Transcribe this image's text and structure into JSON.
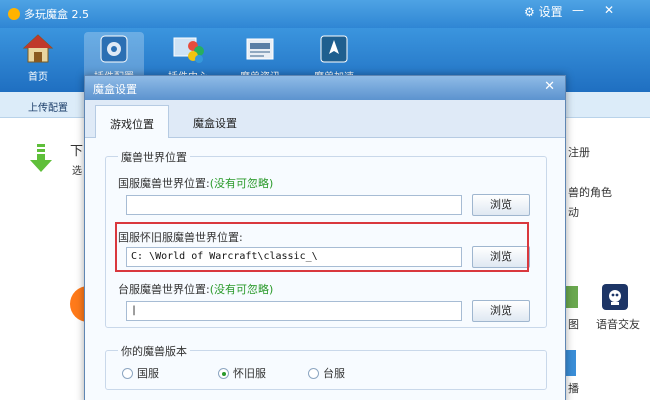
{
  "app": {
    "title": "多玩魔盒 2.5",
    "settings_label": "设置",
    "minimize": "—",
    "close": "✕"
  },
  "toolbar": {
    "items": [
      {
        "label": "首页",
        "icon": "home-icon"
      },
      {
        "label": "插件配置",
        "icon": "plugin-config-icon"
      },
      {
        "label": "插件中心",
        "icon": "plugin-center-icon"
      },
      {
        "label": "魔兽资讯",
        "icon": "news-icon"
      },
      {
        "label": "魔兽加速",
        "icon": "accelerate-icon"
      }
    ]
  },
  "subbar": {
    "upload_label": "上传配置"
  },
  "background": {
    "down_text": "下",
    "select_text": "选",
    "register_text": "注册",
    "role_text": "兽的角色",
    "move_text": "动",
    "map_text": "图",
    "voice_text": "语音交友",
    "broadcast_text": "播"
  },
  "dialog": {
    "title": "魔盒设置",
    "close": "✕",
    "tabs": [
      {
        "label": "游戏位置",
        "active": true
      },
      {
        "label": "魔盒设置",
        "active": false
      }
    ],
    "location_group": {
      "title": "魔兽世界位置",
      "rows": [
        {
          "label": "国服魔兽世界位置:",
          "hint": "(没有可忽略)",
          "value": "",
          "button": "浏览"
        },
        {
          "label": "国服怀旧服魔兽世界位置:",
          "hint": "",
          "value": "C: \\World of Warcraft\\classic_\\",
          "button": "浏览"
        },
        {
          "label": "台服魔兽世界位置:",
          "hint": "(没有可忽略)",
          "value": "|",
          "button": "浏览"
        }
      ]
    },
    "version_group": {
      "title": "你的魔兽版本",
      "options": [
        {
          "label": "国服",
          "selected": false
        },
        {
          "label": "怀旧服",
          "selected": true
        },
        {
          "label": "台服",
          "selected": false
        }
      ]
    }
  }
}
